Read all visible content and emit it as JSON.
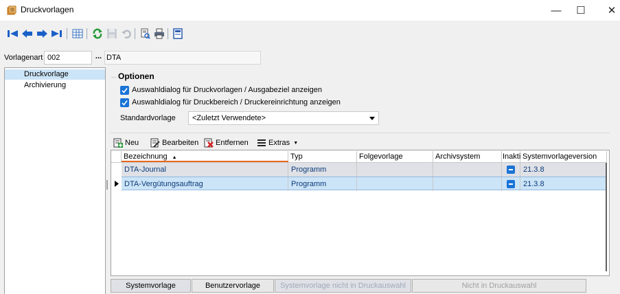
{
  "window": {
    "title": "Druckvorlagen",
    "buttons": {
      "minimize": "—",
      "maximize": "☐",
      "close": "✕"
    }
  },
  "toolbar": {
    "icons": [
      "first-record-icon",
      "previous-record-icon",
      "next-record-icon",
      "last-record-icon",
      "table-view-icon",
      "refresh-icon",
      "save-icon",
      "undo-icon",
      "print-preview-icon",
      "print-icon",
      "form-icon"
    ]
  },
  "vorlagenart": {
    "label": "Vorlagenart",
    "code": "002",
    "lookup_label": "...",
    "name": "DTA"
  },
  "nav": {
    "items": [
      {
        "label": "Druckvorlage",
        "selected": true
      },
      {
        "label": "Archivierung",
        "selected": false
      }
    ]
  },
  "options": {
    "title": "Optionen",
    "check1": "Auswahldialog für Druckvorlagen / Ausgabeziel anzeigen",
    "check2": "Auswahldialog für Druckbereich / Druckereinrichtung anzeigen",
    "standard_label": "Standardvorlage",
    "standard_value": "<Zuletzt Verwendete>"
  },
  "grid_toolbar": {
    "neu": "Neu",
    "bearbeiten": "Bearbeiten",
    "entfernen": "Entfernen",
    "extras": "Extras"
  },
  "grid": {
    "columns": [
      "Bezeichnung",
      "Typ",
      "Folgevorlage",
      "Archivsystem",
      "Inaktiv",
      "Systemvorlageversion"
    ],
    "sort_indicator": "▲",
    "rows": [
      {
        "bezeichnung": "DTA-Journal",
        "typ": "Programm",
        "folgevorlage": "",
        "archivsystem": "",
        "inaktiv": true,
        "version": "21.3.8"
      },
      {
        "bezeichnung": "DTA-Vergütungsauftrag",
        "typ": "Programm",
        "folgevorlage": "",
        "archivsystem": "",
        "inaktiv": true,
        "version": "21.3.8"
      }
    ]
  },
  "legend": {
    "systemvorlage": "Systemvorlage",
    "benutzervorlage": "Benutzervorlage",
    "system_nicht": "Systemvorlage nicht in Druckauswahl",
    "nicht": "Nicht in Druckauswahl"
  },
  "colors": {
    "selection": "#cce4f7",
    "row_systemvorlage": "#dfe1e6",
    "accent": "#1a73d6"
  }
}
